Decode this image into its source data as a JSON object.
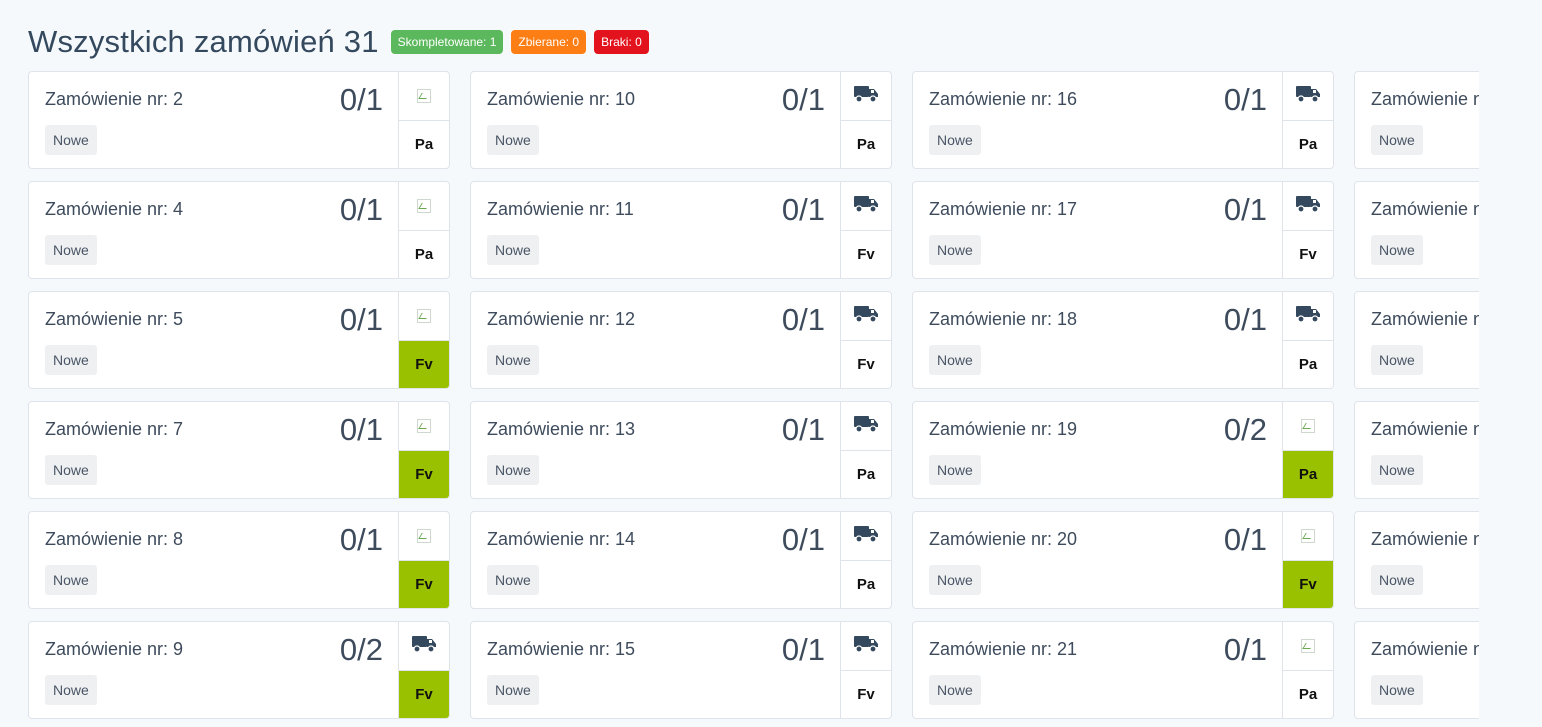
{
  "header": {
    "title": "Wszystkich zamówień 31",
    "badges": {
      "completed": "Skompletowane: 1",
      "picking": "Zbierane:  0",
      "missing": "Braki:  0"
    }
  },
  "colors": {
    "green": "#5cb85c",
    "orange": "#fd7e14",
    "red": "#e3131e",
    "doc_active": "#99c100"
  },
  "columns": [
    {
      "cards": [
        {
          "order": "Zamówienie nr: 2",
          "count": "0/1",
          "status": "Nowe",
          "icon": "image-icon",
          "doc": "Pa",
          "doc_active": false
        },
        {
          "order": "Zamówienie nr: 4",
          "count": "0/1",
          "status": "Nowe",
          "icon": "image-icon",
          "doc": "Pa",
          "doc_active": false
        },
        {
          "order": "Zamówienie nr: 5",
          "count": "0/1",
          "status": "Nowe",
          "icon": "image-icon",
          "doc": "Fv",
          "doc_active": true
        },
        {
          "order": "Zamówienie nr: 7",
          "count": "0/1",
          "status": "Nowe",
          "icon": "image-icon",
          "doc": "Fv",
          "doc_active": true
        },
        {
          "order": "Zamówienie nr: 8",
          "count": "0/1",
          "status": "Nowe",
          "icon": "image-icon",
          "doc": "Fv",
          "doc_active": true
        },
        {
          "order": "Zamówienie nr: 9",
          "count": "0/2",
          "status": "Nowe",
          "icon": "truck-icon",
          "doc": "Fv",
          "doc_active": true
        }
      ]
    },
    {
      "cards": [
        {
          "order": "Zamówienie nr: 10",
          "count": "0/1",
          "status": "Nowe",
          "icon": "truck-icon",
          "doc": "Pa",
          "doc_active": false
        },
        {
          "order": "Zamówienie nr: 11",
          "count": "0/1",
          "status": "Nowe",
          "icon": "truck-icon",
          "doc": "Fv",
          "doc_active": false
        },
        {
          "order": "Zamówienie nr: 12",
          "count": "0/1",
          "status": "Nowe",
          "icon": "truck-icon",
          "doc": "Fv",
          "doc_active": false
        },
        {
          "order": "Zamówienie nr: 13",
          "count": "0/1",
          "status": "Nowe",
          "icon": "truck-icon",
          "doc": "Pa",
          "doc_active": false
        },
        {
          "order": "Zamówienie nr: 14",
          "count": "0/1",
          "status": "Nowe",
          "icon": "truck-icon",
          "doc": "Pa",
          "doc_active": false
        },
        {
          "order": "Zamówienie nr: 15",
          "count": "0/1",
          "status": "Nowe",
          "icon": "truck-icon",
          "doc": "Fv",
          "doc_active": false
        }
      ]
    },
    {
      "cards": [
        {
          "order": "Zamówienie nr: 16",
          "count": "0/1",
          "status": "Nowe",
          "icon": "truck-icon",
          "doc": "Pa",
          "doc_active": false
        },
        {
          "order": "Zamówienie nr: 17",
          "count": "0/1",
          "status": "Nowe",
          "icon": "truck-icon",
          "doc": "Fv",
          "doc_active": false
        },
        {
          "order": "Zamówienie nr: 18",
          "count": "0/1",
          "status": "Nowe",
          "icon": "truck-icon",
          "doc": "Pa",
          "doc_active": false
        },
        {
          "order": "Zamówienie nr: 19",
          "count": "0/2",
          "status": "Nowe",
          "icon": "image-icon",
          "doc": "Pa",
          "doc_active": true
        },
        {
          "order": "Zamówienie nr: 20",
          "count": "0/1",
          "status": "Nowe",
          "icon": "image-icon",
          "doc": "Fv",
          "doc_active": true
        },
        {
          "order": "Zamówienie nr: 21",
          "count": "0/1",
          "status": "Nowe",
          "icon": "image-icon",
          "doc": "Pa",
          "doc_active": false
        }
      ]
    },
    {
      "cards": [
        {
          "order": "Zamówienie nr",
          "count": "",
          "status": "Nowe",
          "icon": "",
          "doc": "",
          "doc_active": false
        },
        {
          "order": "Zamówienie nr",
          "count": "",
          "status": "Nowe",
          "icon": "",
          "doc": "",
          "doc_active": false
        },
        {
          "order": "Zamówienie nr",
          "count": "",
          "status": "Nowe",
          "icon": "",
          "doc": "",
          "doc_active": false
        },
        {
          "order": "Zamówienie nr",
          "count": "",
          "status": "Nowe",
          "icon": "",
          "doc": "",
          "doc_active": false
        },
        {
          "order": "Zamówienie nr",
          "count": "",
          "status": "Nowe",
          "icon": "",
          "doc": "",
          "doc_active": false
        },
        {
          "order": "Zamówienie nr",
          "count": "",
          "status": "Nowe",
          "icon": "",
          "doc": "",
          "doc_active": false
        }
      ]
    }
  ]
}
